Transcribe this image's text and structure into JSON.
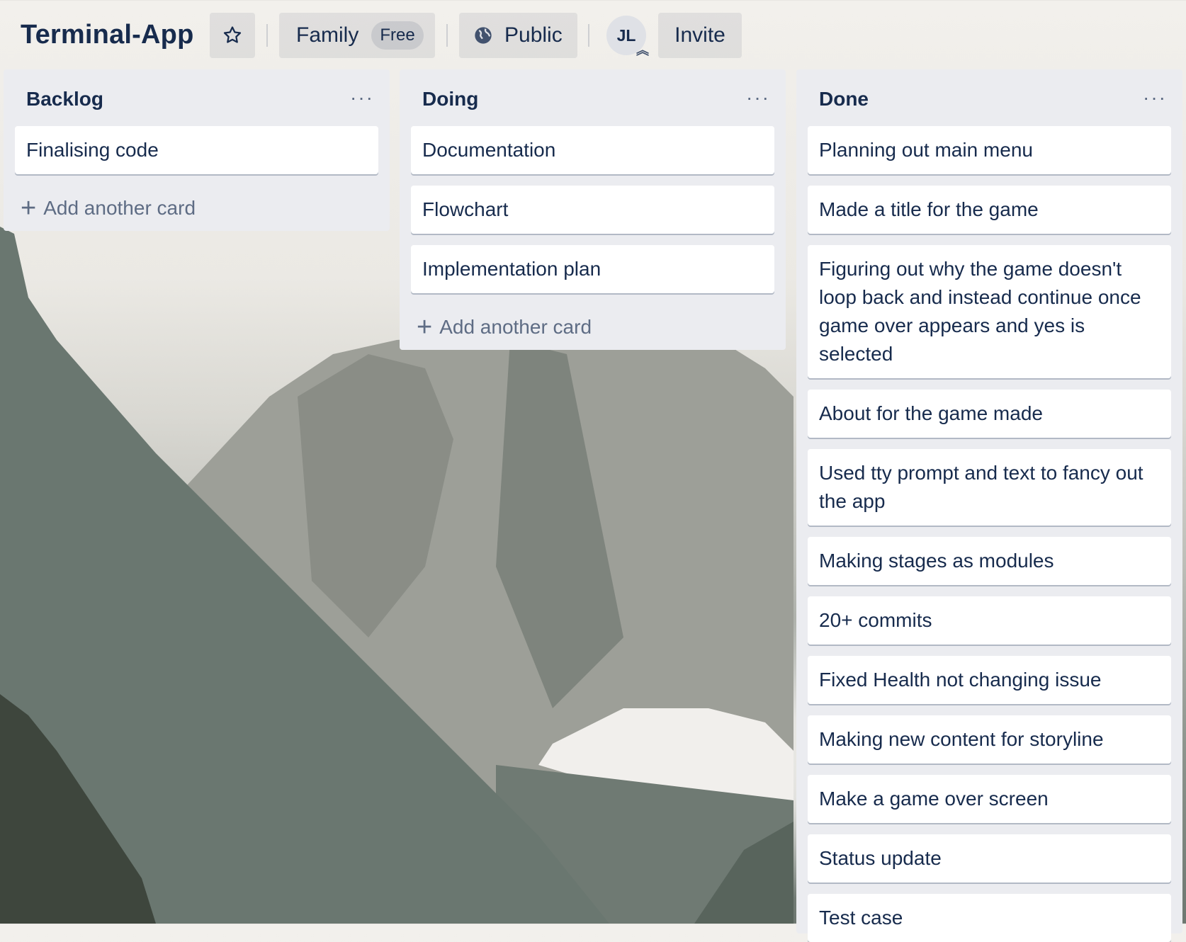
{
  "board": {
    "title": "Terminal-App",
    "workspace_label": "Family",
    "plan_badge": "Free",
    "visibility_label": "Public",
    "member_initials": "JL",
    "invite_label": "Invite"
  },
  "icons": {
    "star": "star-icon",
    "globe": "globe-icon",
    "more": "more-horizontal-icon",
    "plus": "plus-icon",
    "admin": "admin-chevron-icon"
  },
  "colors": {
    "list_bg": "#ebecf0",
    "text": "#172b4d",
    "muted": "#5e6c84"
  },
  "lists": [
    {
      "title": "Backlog",
      "menu": "···",
      "cards": [
        "Finalising code"
      ],
      "add_label": "Add another card",
      "plus": "+"
    },
    {
      "title": "Doing",
      "menu": "···",
      "cards": [
        "Documentation",
        "Flowchart",
        "Implementation plan"
      ],
      "add_label": "Add another card",
      "plus": "+"
    },
    {
      "title": "Done",
      "menu": "···",
      "cards": [
        "Planning out main menu",
        "Made a title for the game",
        "Figuring out why the game doesn't loop back and instead continue once game over appears and yes is selected",
        "About for the game made",
        "Used tty prompt and text to fancy out the app",
        "Making stages as modules",
        "20+ commits",
        "Fixed Health not changing issue",
        "Making new content for storyline",
        "Make a game over screen",
        "Status update",
        "Test case"
      ]
    }
  ]
}
